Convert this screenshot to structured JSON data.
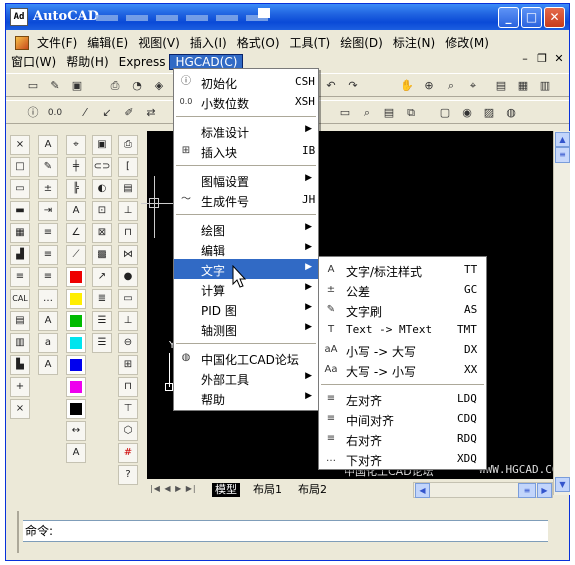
{
  "window": {
    "title": "AutoCAD",
    "app_icon": "Ad"
  },
  "caption_buttons": {
    "minimize": "_",
    "maximize": "□",
    "close": "✕"
  },
  "menubar": {
    "row1": [
      "文件(F)",
      "编辑(E)",
      "视图(V)",
      "插入(I)",
      "格式(O)",
      "工具(T)",
      "绘图(D)",
      "标注(N)",
      "修改(M)"
    ],
    "row2": [
      "窗口(W)",
      "帮助(H)",
      "Express",
      "HGCAD(C)"
    ],
    "mdi_controls": {
      "minimize": "–",
      "restore": "❐",
      "close": "✕"
    }
  },
  "hgcad_menu": [
    {
      "label": "初始化",
      "shortcut": "CSH",
      "icon": "init-icon"
    },
    {
      "label": "小数位数",
      "shortcut": "XSH",
      "icon": "decimal-icon"
    },
    {
      "label": "标准设计",
      "submenu": true
    },
    {
      "label": "插入块",
      "shortcut": "IB",
      "icon": "insert-block-icon"
    },
    {
      "label": "图幅设置",
      "submenu": true
    },
    {
      "label": "生成件号",
      "shortcut": "JH",
      "icon": "part-number-icon"
    },
    {
      "label": "绘图",
      "submenu": true
    },
    {
      "label": "编辑",
      "submenu": true
    },
    {
      "label": "文字",
      "submenu": true
    },
    {
      "label": "计算",
      "submenu": true
    },
    {
      "label": "PID 图",
      "submenu": true
    },
    {
      "label": "轴测图",
      "submenu": true
    },
    {
      "label": "中国化工CAD论坛",
      "icon": "forum-icon"
    },
    {
      "label": "外部工具",
      "submenu": true
    },
    {
      "label": "帮助",
      "submenu": true
    }
  ],
  "text_submenu": [
    {
      "label": "文字/标注样式",
      "shortcut": "TT"
    },
    {
      "label": "公差",
      "shortcut": "GC"
    },
    {
      "label": "文字刷",
      "shortcut": "AS"
    },
    {
      "label": "Text -> MText",
      "shortcut": "TMT"
    },
    {
      "label": "小写 -> 大写",
      "shortcut": "DX"
    },
    {
      "label": "大写 -> 小写",
      "shortcut": "XX"
    },
    {
      "label": "左对齐",
      "shortcut": "LDQ"
    },
    {
      "label": "中间对齐",
      "shortcut": "CDQ"
    },
    {
      "label": "右对齐",
      "shortcut": "RDQ"
    },
    {
      "label": "下对齐",
      "shortcut": "XDQ"
    }
  ],
  "canvas": {
    "watermark_left": "中国化工CAD论坛",
    "watermark_right": "WWW.HGCAD.COM"
  },
  "tabs": [
    "模型",
    "布局1",
    "布局2"
  ],
  "command": {
    "prompt": "命令:"
  },
  "colors": {
    "titlebar": "#0a4ad7",
    "highlight": "#316ac5",
    "canvas": "#000000"
  }
}
